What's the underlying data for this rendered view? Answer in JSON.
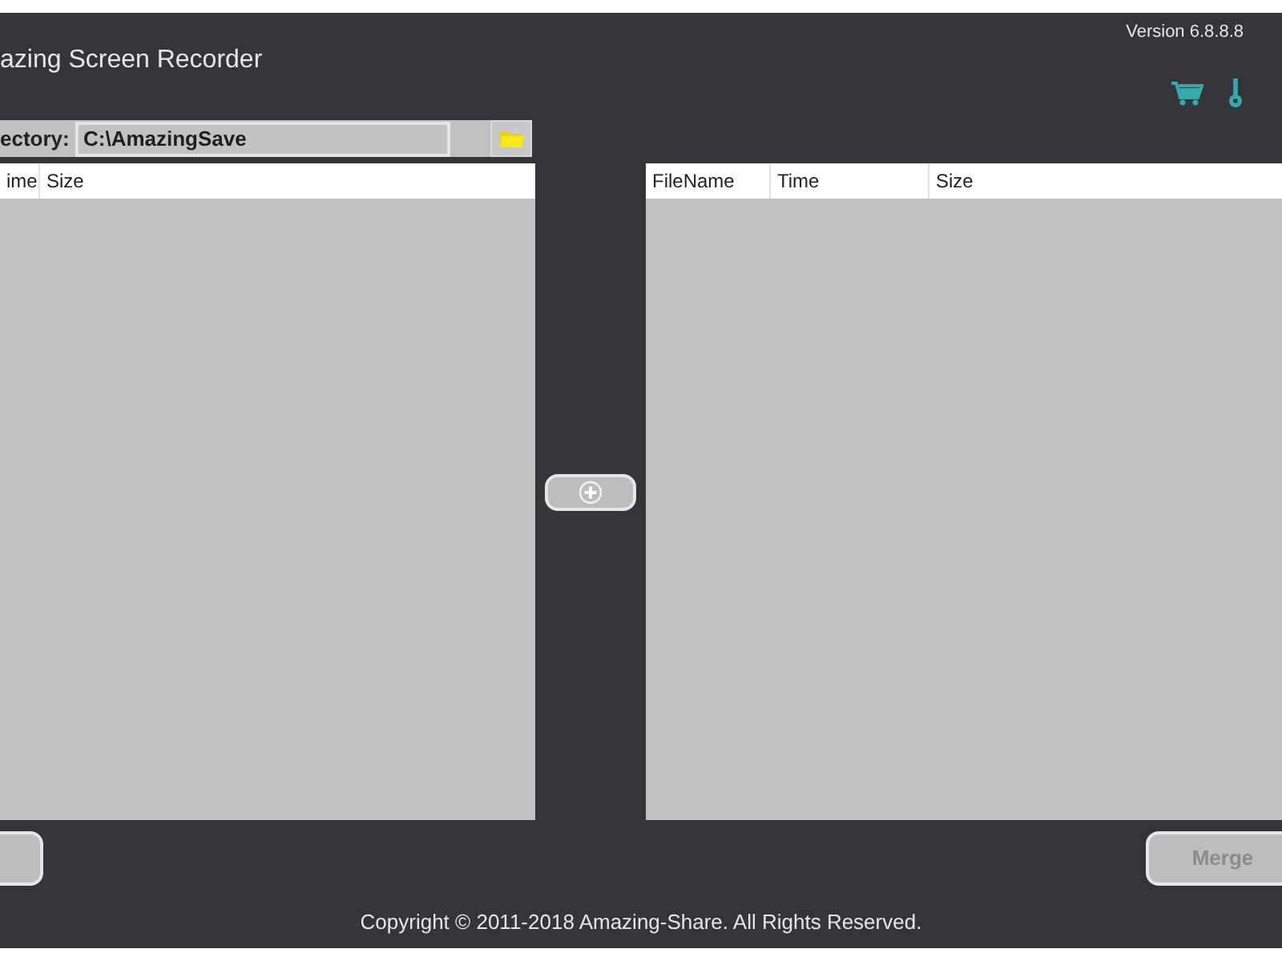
{
  "window": {
    "title": "azing Screen Recorder",
    "version": "Version 6.8.8.8"
  },
  "directory": {
    "label": "ectory:",
    "value": "C:\\AmazingSave"
  },
  "left_list": {
    "columns": [
      "ime",
      "Size"
    ]
  },
  "right_list": {
    "columns": [
      "FileName",
      "Time",
      "Size"
    ]
  },
  "merge_button": {
    "label": "Merge",
    "disabled": true
  },
  "footer": {
    "copyright": "Copyright © 2011-2018 Amazing-Share. All Rights Reserved."
  }
}
